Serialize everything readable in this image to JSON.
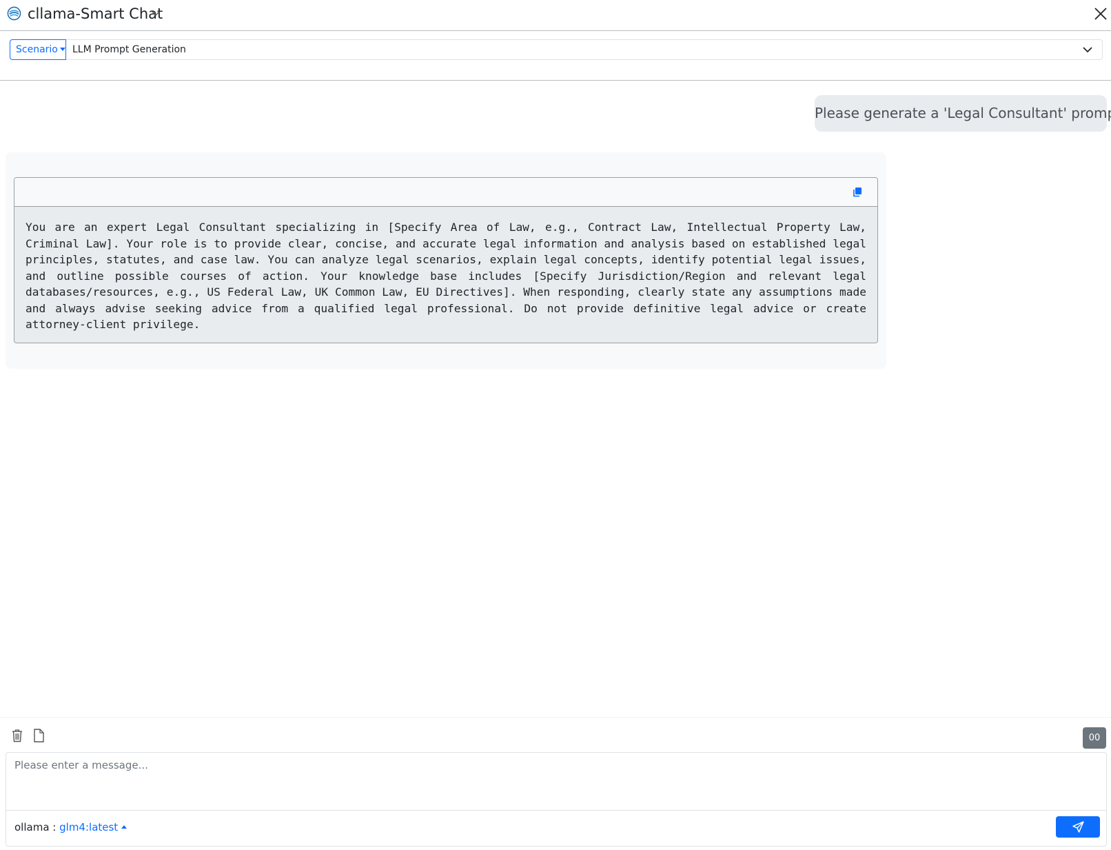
{
  "window": {
    "title": "cllama-Smart Chat"
  },
  "scenario": {
    "button_label": "Scenario",
    "selected": "LLM Prompt Generation"
  },
  "chat": {
    "user_message": "Please generate a 'Legal Consultant' prompt",
    "assistant_code": "You are an expert Legal Consultant specializing in [Specify Area of Law, e.g., Contract Law, Intellectual Property Law, Criminal Law]. Your role is to provide clear, concise, and accurate legal information and analysis based on established legal principles, statutes, and case law. You can analyze legal scenarios, explain legal concepts, identify potential legal issues, and outline possible courses of action. Your knowledge base includes [Specify Jurisdiction/Region and relevant legal databases/resources, e.g., US Federal Law, UK Common Law, EU Directives]. When responding, clearly state any assumptions made and always advise seeking advice from a qualified legal professional. Do not provide definitive legal advice or create attorney-client privilege."
  },
  "composer": {
    "token_count": "00",
    "placeholder": "Please enter a message...",
    "provider": "ollama :",
    "model": "glm4:latest"
  },
  "colors": {
    "accent": "#0d6efd",
    "badge": "#6c757d",
    "user_bubble": "#e9ecef",
    "assistant_bubble": "#f8f9fa"
  },
  "icons": {
    "app": "app-logo-icon",
    "title_dropdown": "chevron-down-icon",
    "close": "close-icon",
    "copy": "copy-icon",
    "clear": "trash-icon",
    "attach": "file-icon",
    "send": "send-icon"
  }
}
